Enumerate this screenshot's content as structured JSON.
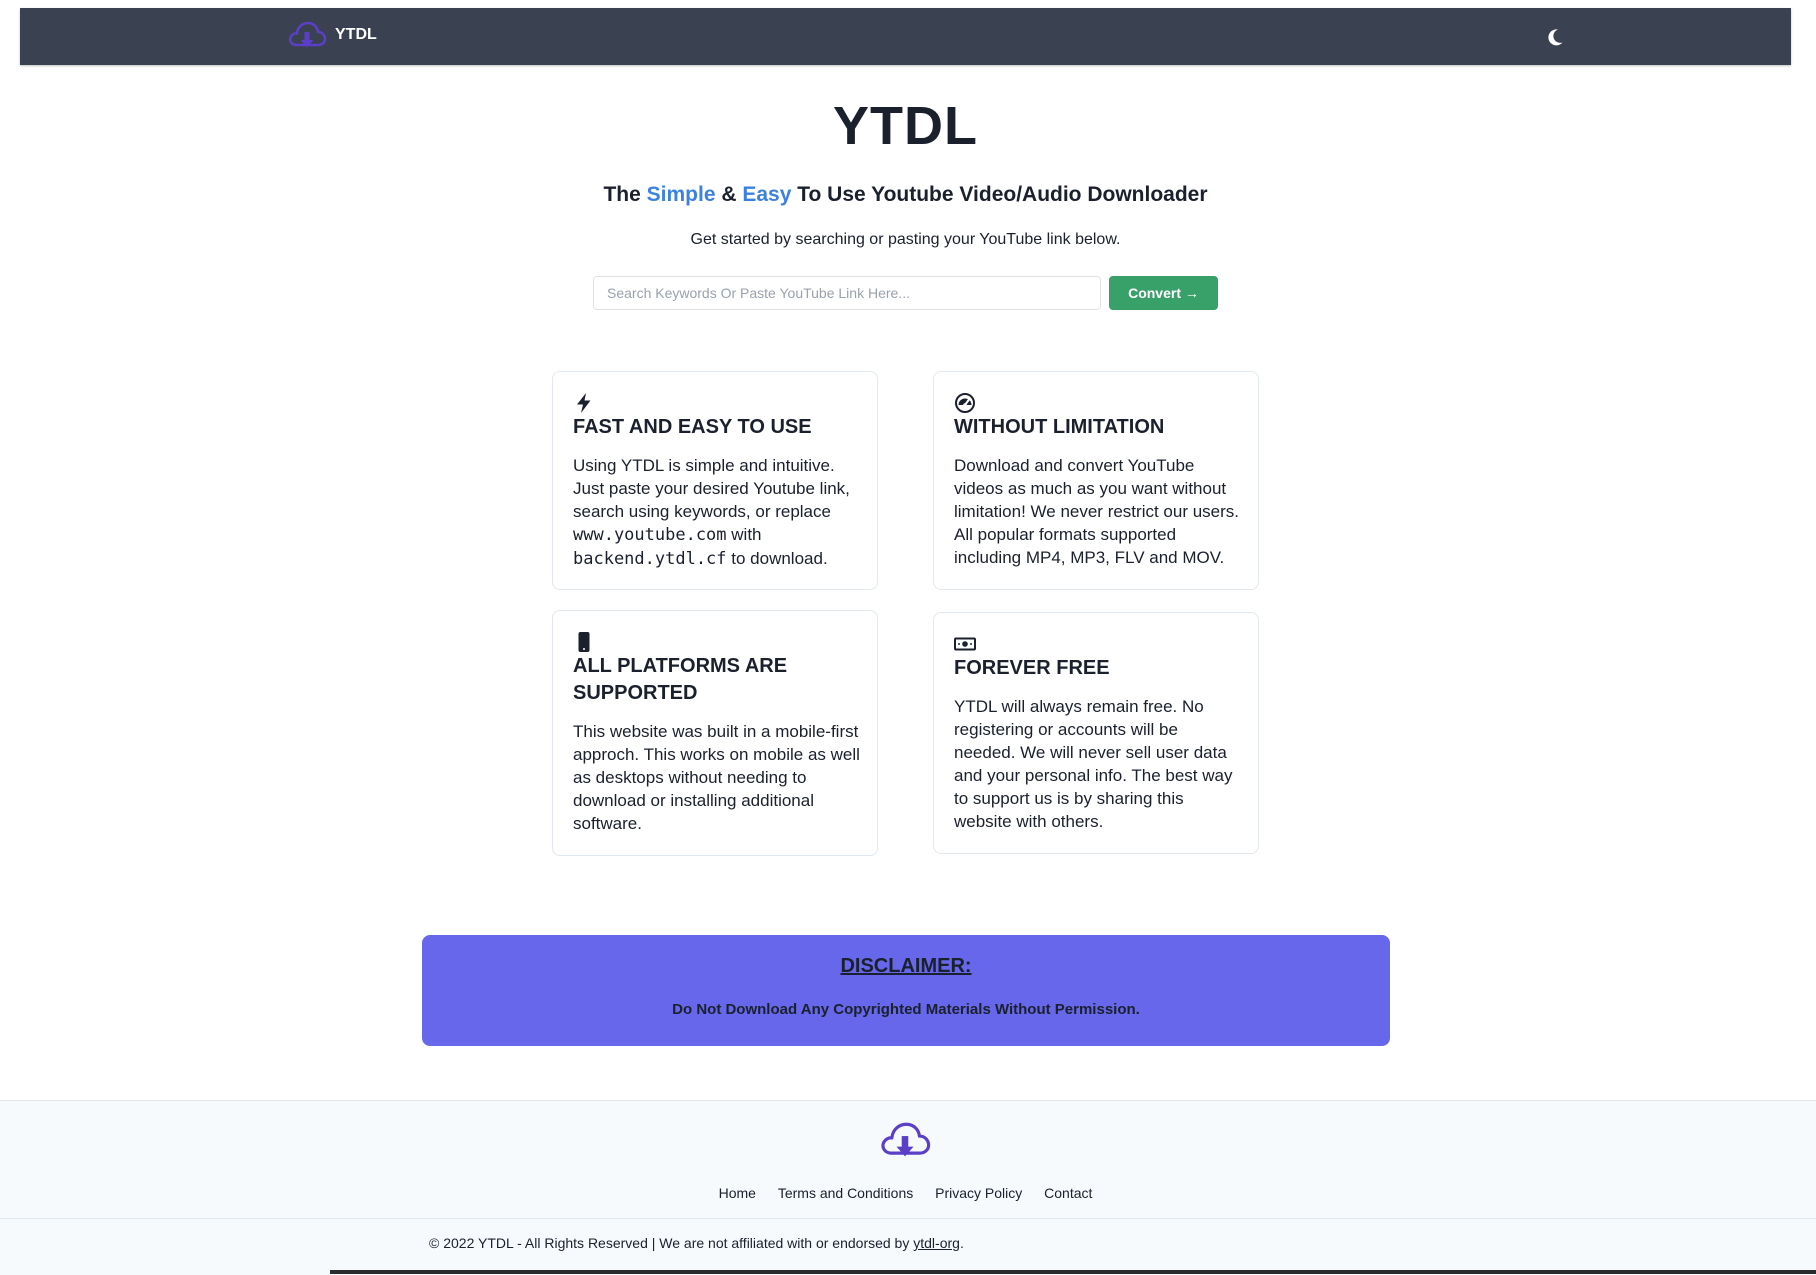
{
  "nav": {
    "brand": "YTDL",
    "theme_icon": "moon-icon"
  },
  "hero": {
    "title": "YTDL",
    "subtitle_prefix": "The ",
    "subtitle_simple": "Simple",
    "subtitle_amp": " & ",
    "subtitle_easy": "Easy",
    "subtitle_suffix": " To Use Youtube Video/Audio Downloader",
    "description": "Get started by searching or pasting your YouTube link below."
  },
  "search": {
    "placeholder": "Search Keywords Or Paste YouTube Link Here...",
    "value": "",
    "button_label": "Convert →"
  },
  "features": [
    {
      "icon": "lightning-icon",
      "title": "FAST AND EASY TO USE",
      "text_part1": "Using YTDL is simple and intuitive. Just paste your desired Youtube link, search using keywords, or replace",
      "code1": "www.youtube.com",
      "text_part2": "with",
      "code2": "backend.ytdl.cf",
      "text_part3": "to download."
    },
    {
      "icon": "speedometer-icon",
      "title": "WITHOUT LIMITATION",
      "text": "Download and convert YouTube videos as much as you want without limitation! We never restrict our users. All popular formats supported including MP4, MP3, FLV and MOV."
    },
    {
      "icon": "mobile-phone-icon",
      "title_line1": "ALL PLATFORMS ARE",
      "title_line2": "SUPPORTED",
      "text": "This website was built in a mobile-first approch. This works on mobile as well as desktops without needing to download or installing additional software."
    },
    {
      "icon": "money-bill-icon",
      "title": "FOREVER FREE",
      "text": "YTDL will always remain free. No registering or accounts will be needed. We will never sell user data and your personal info. The best way to support us is by sharing this website with others."
    }
  ],
  "disclaimer": {
    "title": "DISCLAIMER:",
    "text": "Do Not Download Any Copyrighted Materials Without Permission."
  },
  "footer": {
    "links": [
      "Home",
      "Terms and Conditions",
      "Privacy Policy",
      "Contact"
    ],
    "copyright_prefix": "© 2022 YTDL - All Rights Reserved | We are not affiliated with or endorsed by ",
    "copyright_link": "ytdl-org",
    "copyright_suffix": "."
  },
  "colors": {
    "navbar_bg": "#3a4150",
    "accent_blue": "#3b82e0",
    "convert_green": "#38a169",
    "disclaimer_bg": "#6667eb",
    "logo_purple": "#5b3fc7"
  }
}
